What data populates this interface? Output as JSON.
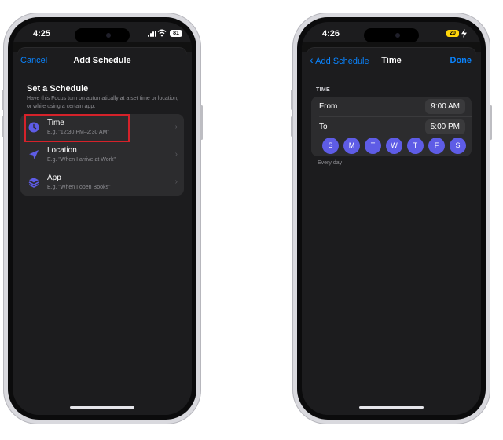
{
  "left_phone": {
    "status": {
      "time": "4:25",
      "battery": "81"
    },
    "nav": {
      "cancel": "Cancel",
      "title": "Add Schedule"
    },
    "section": {
      "title": "Set a Schedule",
      "description": "Have this Focus turn on automatically at a set time or location, or while using a certain app."
    },
    "options": [
      {
        "label": "Time",
        "subtitle": "E.g. \"12:30 PM–2:30 AM\"",
        "icon": "clock-icon"
      },
      {
        "label": "Location",
        "subtitle": "E.g. \"When I arrive at Work\"",
        "icon": "location-arrow-icon"
      },
      {
        "label": "App",
        "subtitle": "E.g. \"When I open Books\"",
        "icon": "app-layers-icon"
      }
    ],
    "highlight_color": "#d5222a"
  },
  "right_phone": {
    "status": {
      "time": "4:26",
      "battery": "20"
    },
    "nav": {
      "back": "Add Schedule",
      "title": "Time",
      "done": "Done"
    },
    "caption": "TIME",
    "from": {
      "label": "From",
      "value": "9:00 AM"
    },
    "to": {
      "label": "To",
      "value": "5:00 PM"
    },
    "days": [
      "S",
      "M",
      "T",
      "W",
      "T",
      "F",
      "S"
    ],
    "repeat_text": "Every day"
  },
  "colors": {
    "accent": "#0a84ff",
    "day_selected": "#5e5ce6",
    "background": "#1c1c1e"
  }
}
